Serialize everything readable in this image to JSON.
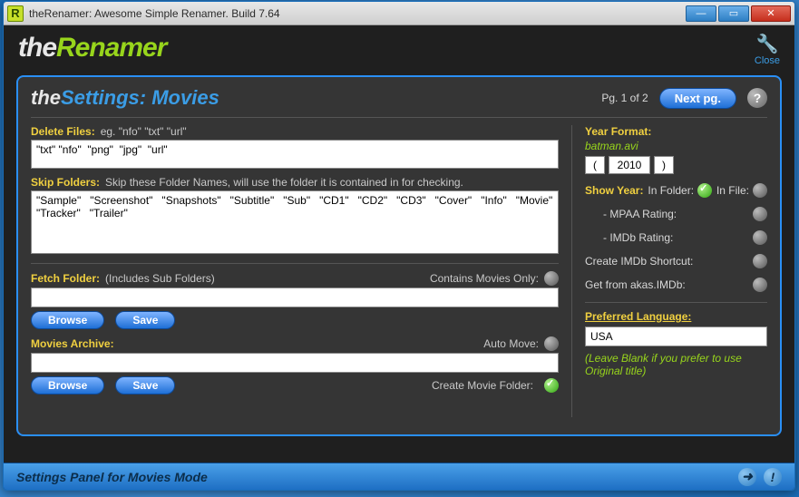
{
  "titlebar": {
    "text": "theRenamer: Awesome Simple Renamer. Build 7.64",
    "icon_letter": "R"
  },
  "header": {
    "logo_part1": "the",
    "logo_part2": "Renamer",
    "close_label": "Close"
  },
  "panel": {
    "title_part1": "the",
    "title_part2": "Settings: Movies",
    "page_indicator": "Pg. 1 of 2",
    "next_label": "Next pg.",
    "help_label": "?"
  },
  "left": {
    "delete_label": "Delete Files:",
    "delete_hint": "eg. \"nfo\"   \"txt\"   \"url\"",
    "delete_value": "\"txt\" \"nfo\"  \"png\"  \"jpg\"  \"url\"",
    "skip_label": "Skip Folders:",
    "skip_hint": "Skip these Folder Names, will use the folder it is contained in for checking.",
    "skip_value": "\"Sample\"   \"Screenshot\"   \"Snapshots\"   \"Subtitle\"   \"Sub\"   \"CD1\"   \"CD2\"   \"CD3\"   \"Cover\"   \"Info\"   \"Movie\"   \"Tracker\"   \"Trailer\"",
    "fetch_label": "Fetch Folder:",
    "fetch_hint": "(Includes Sub Folders)",
    "contains_label": "Contains Movies Only:",
    "browse_label": "Browse",
    "save_label": "Save",
    "archive_label": "Movies Archive:",
    "automove_label": "Auto Move:",
    "create_folder_label": "Create Movie Folder:",
    "fetch_value": "",
    "archive_value": ""
  },
  "right": {
    "yearfmt_label": "Year Format:",
    "yearfmt_example": "batman.avi",
    "year_open": "(",
    "year_value": "2010",
    "year_close": ")",
    "showyear_label": "Show Year:",
    "infolder_label": "In Folder:",
    "infile_label": "In File:",
    "mpaa_label": "- MPAA Rating:",
    "imdb_label": "- IMDb Rating:",
    "shortcut_label": "Create IMDb Shortcut:",
    "akas_label": "Get from akas.IMDb:",
    "preflang_label": "Preferred Language:",
    "preflang_value": "USA",
    "preflang_hint": "(Leave Blank if you prefer to use Original title)"
  },
  "status": {
    "text": "Settings Panel for Movies Mode"
  }
}
